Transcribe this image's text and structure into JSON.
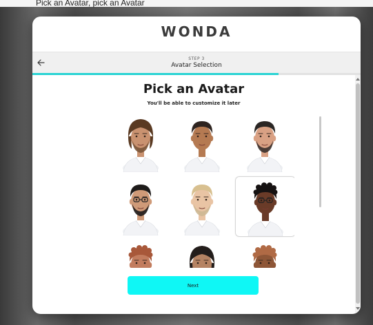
{
  "background": {
    "caption": "Pick an Avatar, pick an Avatar"
  },
  "header": {
    "logo": "WONDA"
  },
  "stepbar": {
    "step_label": "STEP 3",
    "title": "Avatar Selection",
    "progress": 0.75
  },
  "main": {
    "heading": "Pick an Avatar",
    "subheading": "You'll be able to customize it later",
    "next_label": "Next"
  },
  "avatars": [
    {
      "id": "avatar-1",
      "skin": "#c99270",
      "hair": "#5a3a22",
      "hair_style": "long",
      "beard": "#7a5538",
      "glasses": false,
      "selected": false
    },
    {
      "id": "avatar-2",
      "skin": "#b57a52",
      "hair": "#2e2420",
      "hair_style": "short",
      "beard": null,
      "glasses": false,
      "selected": false
    },
    {
      "id": "avatar-3",
      "skin": "#d9a184",
      "hair": "#2a2624",
      "hair_style": "short",
      "beard": "#3a302c",
      "glasses": false,
      "selected": false
    },
    {
      "id": "avatar-4",
      "skin": "#cf9a78",
      "hair": "#1e1b1a",
      "hair_style": "short",
      "beard": "#1e1b1a",
      "glasses": true,
      "selected": false
    },
    {
      "id": "avatar-5",
      "skin": "#e9c4a4",
      "hair": "#d8c090",
      "hair_style": "short",
      "beard": "#cdb894",
      "glasses": false,
      "selected": false
    },
    {
      "id": "avatar-6",
      "skin": "#6a3b28",
      "hair": "#161212",
      "hair_style": "curly",
      "beard": null,
      "glasses": true,
      "selected": true
    },
    {
      "id": "avatar-7",
      "skin": "#c27c5e",
      "hair": "#a8583a",
      "hair_style": "curly",
      "beard": null,
      "glasses": false,
      "selected": false
    },
    {
      "id": "avatar-8",
      "skin": "#b58363",
      "hair": "#231d1b",
      "hair_style": "long",
      "beard": null,
      "glasses": false,
      "selected": false
    },
    {
      "id": "avatar-9",
      "skin": "#8e5637",
      "hair": "#b06a45",
      "hair_style": "curly",
      "beard": null,
      "glasses": false,
      "selected": false
    }
  ],
  "icons": {
    "back": "arrow-left-icon"
  },
  "colors": {
    "accent": "#27d3d3",
    "button": "#0ff7f5"
  }
}
